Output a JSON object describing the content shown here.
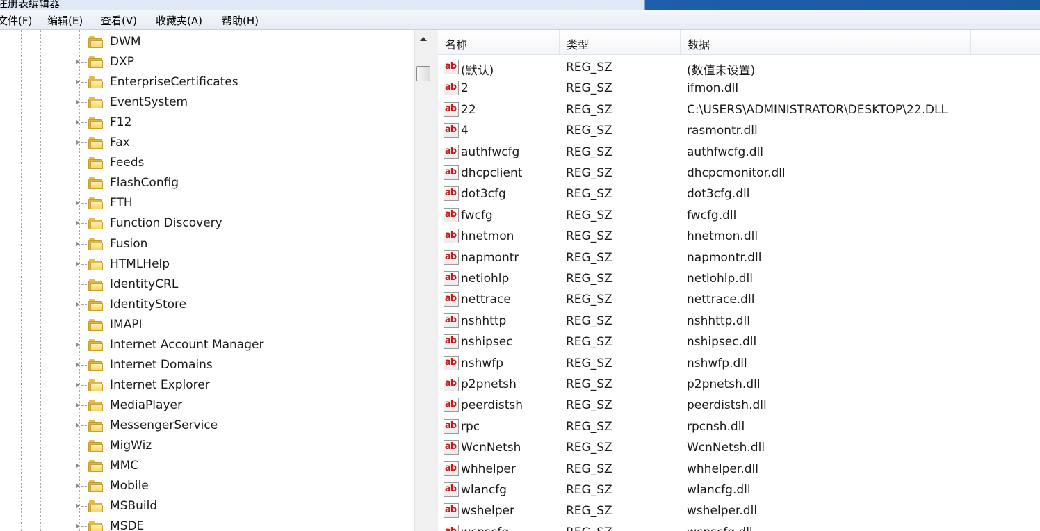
{
  "window": {
    "title": "注册表编辑器"
  },
  "menu": [
    {
      "label": "文件(F)"
    },
    {
      "label": "编辑(E)"
    },
    {
      "label": "查看(V)"
    },
    {
      "label": "收藏夹(A)"
    },
    {
      "label": "帮助(H)"
    }
  ],
  "tree": {
    "items": [
      {
        "label": "DWM",
        "expandable": false
      },
      {
        "label": "DXP",
        "expandable": true
      },
      {
        "label": "EnterpriseCertificates",
        "expandable": true
      },
      {
        "label": "EventSystem",
        "expandable": true
      },
      {
        "label": "F12",
        "expandable": true
      },
      {
        "label": "Fax",
        "expandable": true
      },
      {
        "label": "Feeds",
        "expandable": false
      },
      {
        "label": "FlashConfig",
        "expandable": false
      },
      {
        "label": "FTH",
        "expandable": true
      },
      {
        "label": "Function Discovery",
        "expandable": true
      },
      {
        "label": "Fusion",
        "expandable": true
      },
      {
        "label": "HTMLHelp",
        "expandable": true
      },
      {
        "label": "IdentityCRL",
        "expandable": false
      },
      {
        "label": "IdentityStore",
        "expandable": true
      },
      {
        "label": "IMAPI",
        "expandable": false
      },
      {
        "label": "Internet Account Manager",
        "expandable": true
      },
      {
        "label": "Internet Domains",
        "expandable": true
      },
      {
        "label": "Internet Explorer",
        "expandable": true
      },
      {
        "label": "MediaPlayer",
        "expandable": true
      },
      {
        "label": "MessengerService",
        "expandable": true
      },
      {
        "label": "MigWiz",
        "expandable": false
      },
      {
        "label": "MMC",
        "expandable": true
      },
      {
        "label": "Mobile",
        "expandable": true
      },
      {
        "label": "MSBuild",
        "expandable": true
      },
      {
        "label": "MSDE",
        "expandable": true
      }
    ]
  },
  "list": {
    "columns": [
      {
        "label": "名称"
      },
      {
        "label": "类型"
      },
      {
        "label": "数据"
      }
    ],
    "value_icon_text": "ab",
    "rows": [
      {
        "name": "(默认)",
        "type": "REG_SZ",
        "data": "(数值未设置)"
      },
      {
        "name": "2",
        "type": "REG_SZ",
        "data": "ifmon.dll"
      },
      {
        "name": "22",
        "type": "REG_SZ",
        "data": "C:\\USERS\\ADMINISTRATOR\\DESKTOP\\22.DLL"
      },
      {
        "name": "4",
        "type": "REG_SZ",
        "data": "rasmontr.dll"
      },
      {
        "name": "authfwcfg",
        "type": "REG_SZ",
        "data": "authfwcfg.dll"
      },
      {
        "name": "dhcpclient",
        "type": "REG_SZ",
        "data": "dhcpcmonitor.dll"
      },
      {
        "name": "dot3cfg",
        "type": "REG_SZ",
        "data": "dot3cfg.dll"
      },
      {
        "name": "fwcfg",
        "type": "REG_SZ",
        "data": "fwcfg.dll"
      },
      {
        "name": "hnetmon",
        "type": "REG_SZ",
        "data": "hnetmon.dll"
      },
      {
        "name": "napmontr",
        "type": "REG_SZ",
        "data": "napmontr.dll"
      },
      {
        "name": "netiohlp",
        "type": "REG_SZ",
        "data": "netiohlp.dll"
      },
      {
        "name": "nettrace",
        "type": "REG_SZ",
        "data": "nettrace.dll"
      },
      {
        "name": "nshhttp",
        "type": "REG_SZ",
        "data": "nshhttp.dll"
      },
      {
        "name": "nshipsec",
        "type": "REG_SZ",
        "data": "nshipsec.dll"
      },
      {
        "name": "nshwfp",
        "type": "REG_SZ",
        "data": "nshwfp.dll"
      },
      {
        "name": "p2pnetsh",
        "type": "REG_SZ",
        "data": "p2pnetsh.dll"
      },
      {
        "name": "peerdistsh",
        "type": "REG_SZ",
        "data": "peerdistsh.dll"
      },
      {
        "name": "rpc",
        "type": "REG_SZ",
        "data": "rpcnsh.dll"
      },
      {
        "name": "WcnNetsh",
        "type": "REG_SZ",
        "data": "WcnNetsh.dll"
      },
      {
        "name": "whhelper",
        "type": "REG_SZ",
        "data": "whhelper.dll"
      },
      {
        "name": "wlancfg",
        "type": "REG_SZ",
        "data": "wlancfg.dll"
      },
      {
        "name": "wshelper",
        "type": "REG_SZ",
        "data": "wshelper.dll"
      },
      {
        "name": "wcnscfg",
        "type": "REG_SZ",
        "data": "wcnscfg.dll"
      }
    ]
  }
}
